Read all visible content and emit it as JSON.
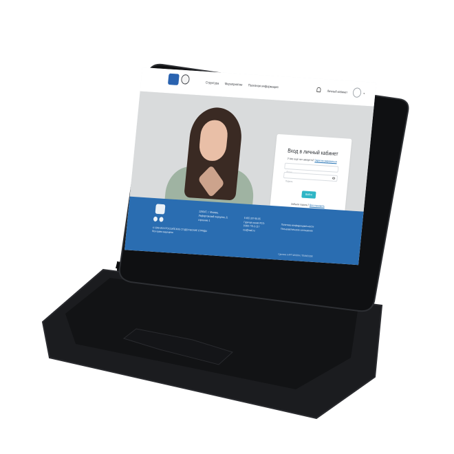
{
  "header": {
    "nav": [
      "Структура",
      "Мероприятия",
      "Полезная информация"
    ],
    "user_link": "Личный кабинет"
  },
  "login": {
    "title": "Вход в личный кабинет",
    "subtitle_prefix": "У вас ещё нет аккаунта? ",
    "subtitle_link": "Зарегистрироваться",
    "email_placeholder": "Логин",
    "password_placeholder": "Пароль",
    "submit_label": "Войти",
    "forgot_prefix": "Забыли пароль? ",
    "forgot_link": "Восстановить"
  },
  "footer": {
    "address": "125047, г. Москва,\nЛефортовский переулок, 8,\nстроение 1",
    "phones": "8 495 357-99-95\nГорячая линия РСО:\n8 800 770-3-117\nrso@mail.ru",
    "links": "Политика конфиденциальности\nПользовательское соглашение",
    "copyright": "© 1999-2024 РОССИЙСКИЕ СТУДЕНЧЕСКИЕ ОТРЯДЫ\nВсе права защищены",
    "developed_by": "Сделано в  АРТ ШКОЛА  |  TEAMCODE"
  },
  "colors": {
    "footer_blue": "#2a6db1",
    "button_teal": "#2fb6c6",
    "device_black": "#0f1012"
  }
}
